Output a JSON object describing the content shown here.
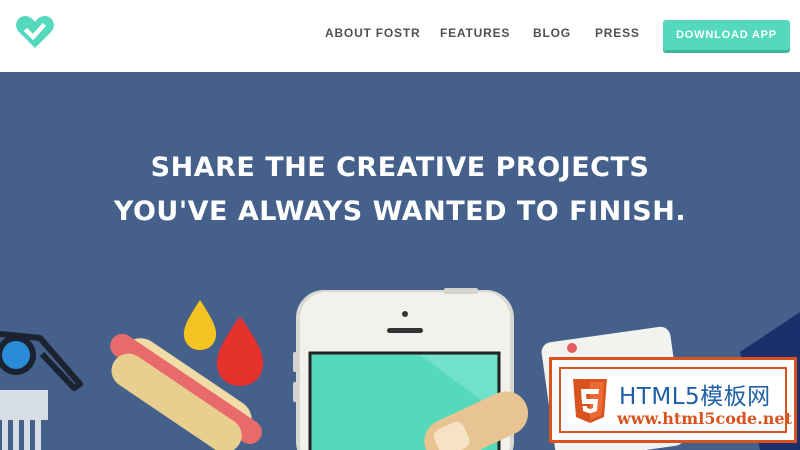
{
  "header": {
    "logo_name": "heart-check-logo",
    "nav": [
      "ABOUT FOSTR",
      "FEATURES",
      "BLOG",
      "PRESS"
    ],
    "download_label": "DOWNLOAD APP"
  },
  "hero": {
    "headline_line1": "SHARE THE CREATIVE PROJECTS",
    "headline_line2": "YOU'VE ALWAYS WANTED TO FINISH."
  },
  "watermark": {
    "title": "HTML5模板网",
    "url": "www.html5code.net"
  },
  "colors": {
    "accent": "#54d9bd",
    "hero_bg": "#44608b",
    "nav_text": "#4f5055",
    "watermark_orange": "#d9531e",
    "watermark_blue": "#1f5fa8"
  }
}
